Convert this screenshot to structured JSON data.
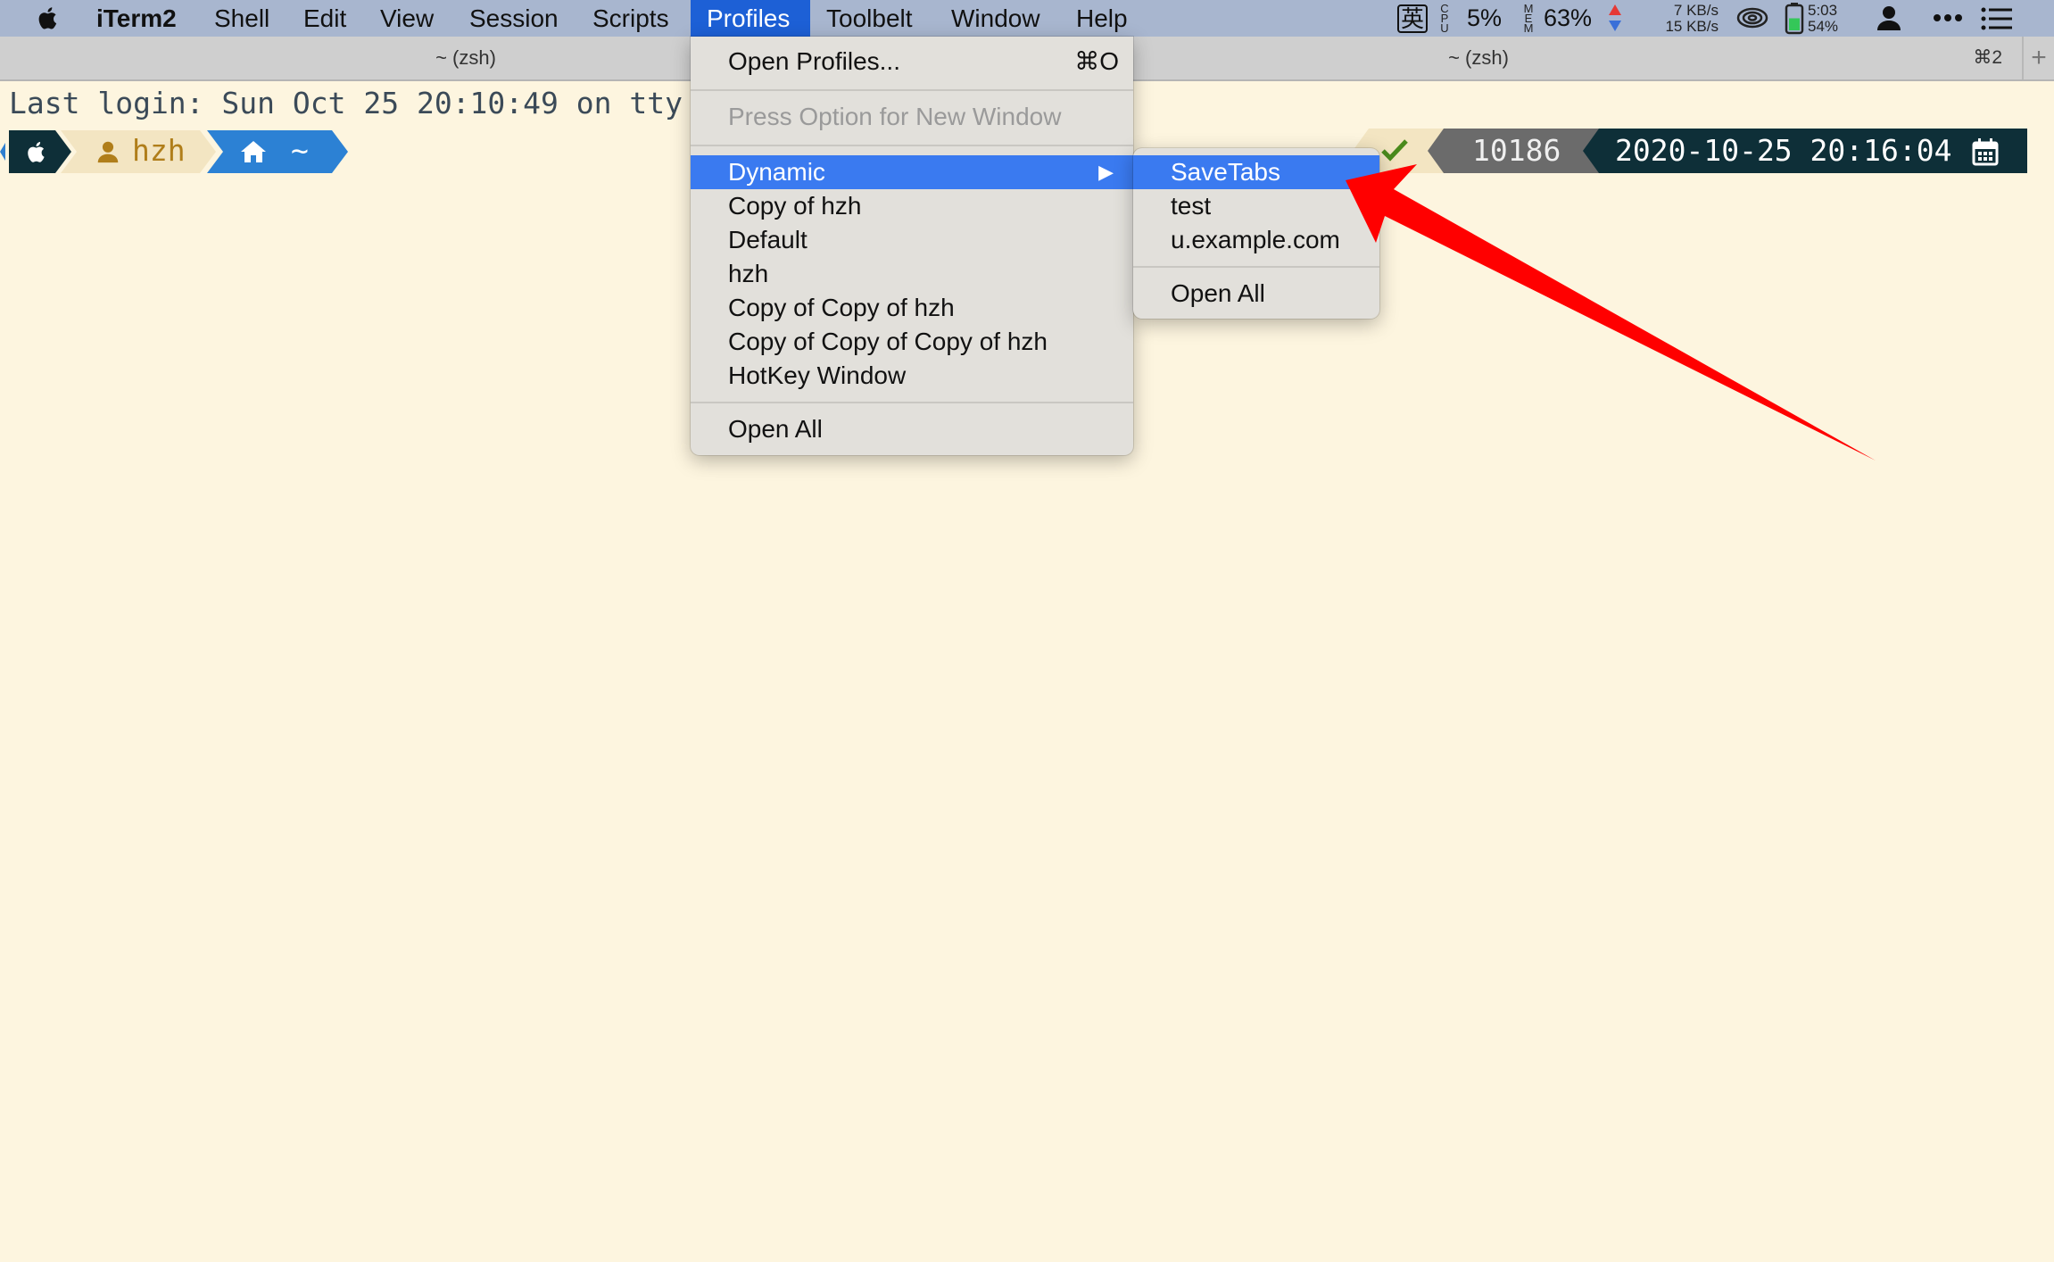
{
  "menubar": {
    "app_name": "iTerm2",
    "items": [
      "Shell",
      "Edit",
      "View",
      "Session",
      "Scripts",
      "Profiles",
      "Toolbelt",
      "Window",
      "Help"
    ],
    "active_item": "Profiles",
    "status": {
      "input_method": "英",
      "cpu_label": "CPU",
      "cpu_value": "5%",
      "mem_label": "MEM",
      "mem_value": "63%",
      "net_up": "7 KB/s",
      "net_down": "15 KB/s",
      "battery_time": "5:03",
      "battery_percent": "54%",
      "battery_level": 0.54
    }
  },
  "tabs": [
    {
      "title": "~ (zsh)"
    },
    {
      "title": "~ (zsh)",
      "shortcut": "⌘2"
    }
  ],
  "new_tab_glyph": "+",
  "terminal": {
    "last_login": "Last login: Sun Oct 25 20:10:49 on tty",
    "prompt_user": "hzh",
    "prompt_dir": "~",
    "right_pid": "10186",
    "right_datetime": "2020-10-25 20:16:04"
  },
  "profiles_menu": {
    "open_profiles": "Open Profiles...",
    "open_profiles_shortcut": "⌘O",
    "press_option": "Press Option for New Window",
    "dynamic": "Dynamic",
    "profiles": [
      "Copy of hzh",
      "Default",
      "hzh",
      "Copy of Copy of hzh",
      "Copy of Copy of Copy of hzh",
      "HotKey Window"
    ],
    "open_all": "Open All"
  },
  "dynamic_submenu": {
    "items": [
      "SaveTabs",
      "test",
      "u.example.com"
    ],
    "open_all": "Open All"
  },
  "colors": {
    "menubar_bg": "#a8b6cf",
    "menu_highlight": "#3a7af0",
    "terminal_bg": "#fdf5df",
    "annotation_arrow": "#ff0000"
  }
}
